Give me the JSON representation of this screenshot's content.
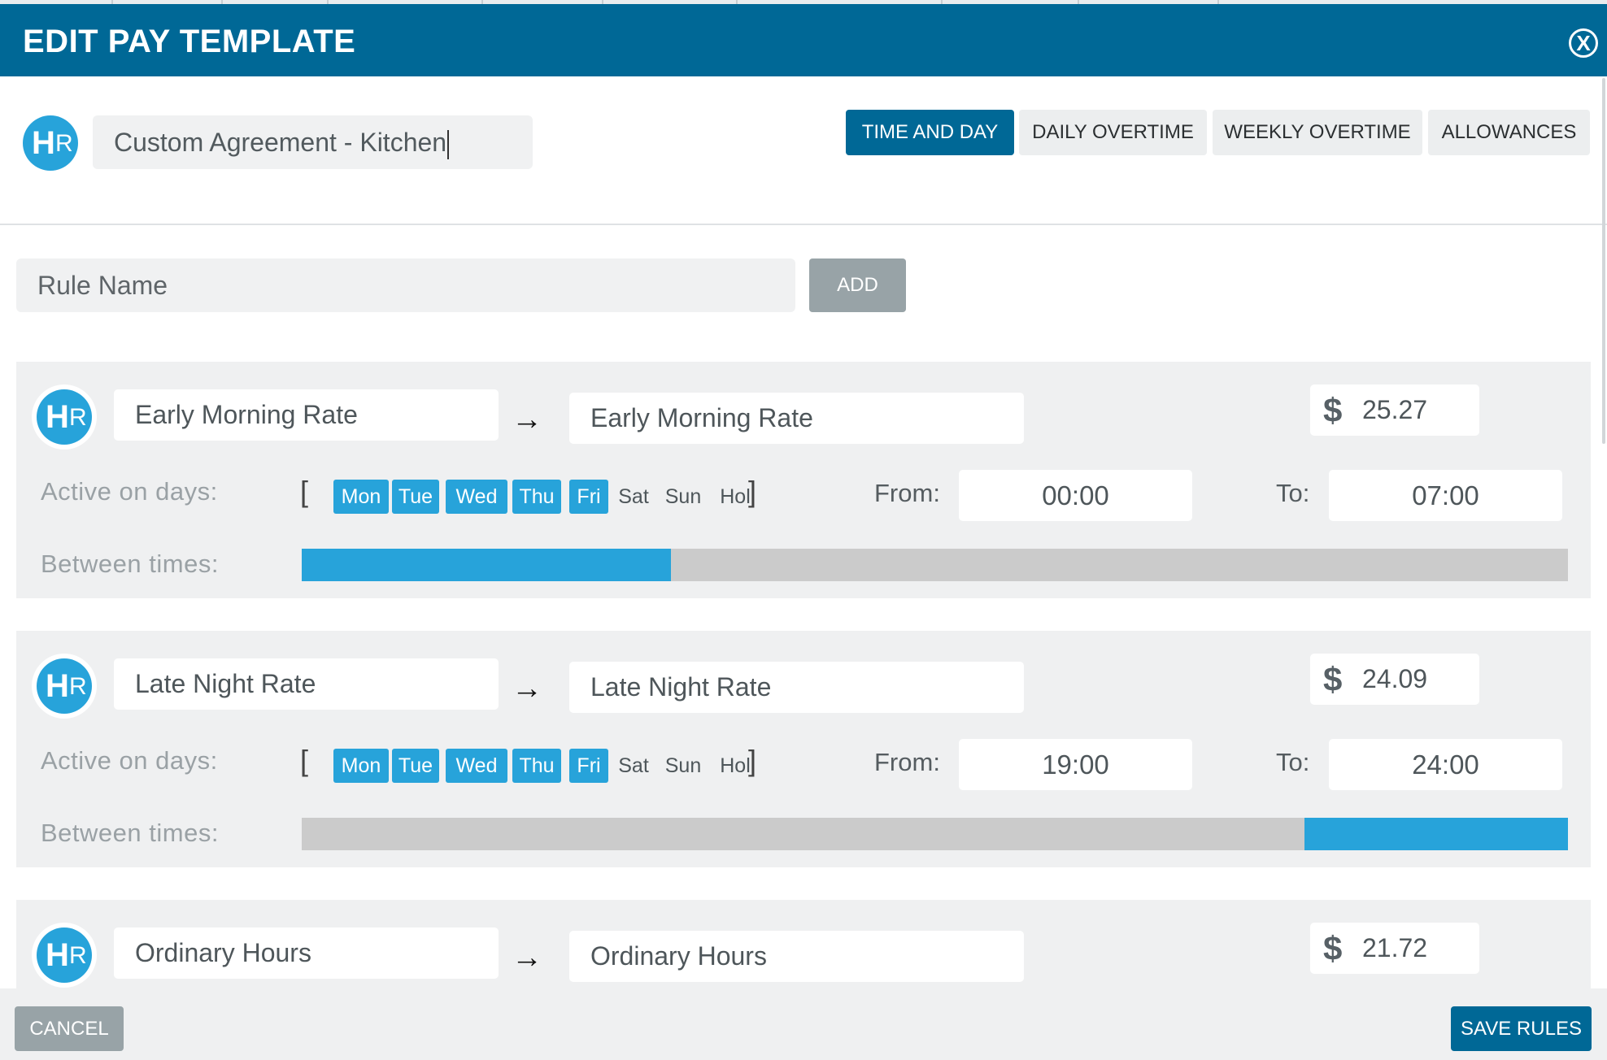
{
  "modal": {
    "title": "EDIT PAY TEMPLATE",
    "close_label": "X",
    "template_name": "Custom Agreement - Kitchen"
  },
  "tabs": [
    {
      "label": "TIME AND DAY",
      "active": true
    },
    {
      "label": "DAILY OVERTIME",
      "active": false
    },
    {
      "label": "WEEKLY OVERTIME",
      "active": false
    },
    {
      "label": "ALLOWANCES",
      "active": false
    }
  ],
  "add_rule": {
    "placeholder": "Rule Name",
    "button_label": "ADD"
  },
  "labels": {
    "active_on_days": "Active on days:",
    "between_times": "Between times:",
    "from": "From:",
    "to": "To:",
    "currency": "$",
    "bracket_open": "[",
    "bracket_close": "]",
    "arrow": "→"
  },
  "logo": {
    "h": "H",
    "r": "R"
  },
  "day_names": [
    "Mon",
    "Tue",
    "Wed",
    "Thu",
    "Fri",
    "Sat",
    "Sun",
    "Hol"
  ],
  "rules": [
    {
      "name": "Early Morning Rate",
      "target": "Early Morning Rate",
      "rate": "25.27",
      "days_active": [
        true,
        true,
        true,
        true,
        true,
        false,
        false,
        false
      ],
      "from": "00:00",
      "to": "07:00",
      "bar_start_fraction": 0.0,
      "bar_end_fraction": 0.2917
    },
    {
      "name": "Late Night Rate",
      "target": "Late Night Rate",
      "rate": "24.09",
      "days_active": [
        true,
        true,
        true,
        true,
        true,
        false,
        false,
        false
      ],
      "from": "19:00",
      "to": "24:00",
      "bar_start_fraction": 0.7917,
      "bar_end_fraction": 1.0
    },
    {
      "name": "Ordinary Hours",
      "target": "Ordinary Hours",
      "rate": "21.72"
    }
  ],
  "footer": {
    "cancel_label": "CANCEL",
    "save_label": "SAVE RULES"
  },
  "colors": {
    "header": "#006896",
    "accent": "#27a3da",
    "card_bg": "#eff0f1",
    "bar_empty": "#cbcbcb"
  }
}
